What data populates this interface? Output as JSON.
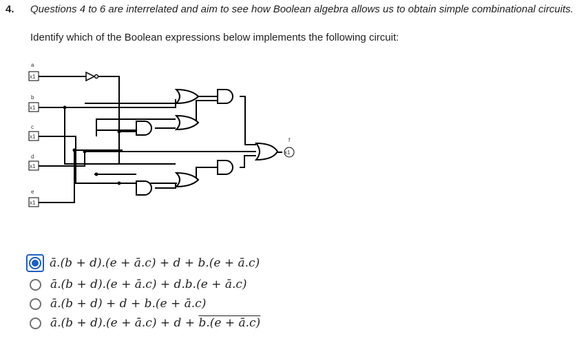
{
  "question": {
    "number": "4.",
    "intro": "Questions 4 to 6 are interrelated and aim to see how Boolean algebra allows us to obtain simple combinational circuits.",
    "prompt": "Identify which of the Boolean expressions below implements the following circuit:"
  },
  "circuit": {
    "inputs": [
      {
        "name": "a",
        "box": "x1"
      },
      {
        "name": "b",
        "box": "x1"
      },
      {
        "name": "c",
        "box": "x1"
      },
      {
        "name": "d",
        "box": "x1"
      },
      {
        "name": "e",
        "box": "x1"
      }
    ],
    "output": {
      "name": "f",
      "box": "x1"
    },
    "gates": [
      "not",
      "or",
      "and",
      "and",
      "or",
      "or",
      "and",
      "and"
    ],
    "colors": {
      "wire": "#000000",
      "junction": "#000000"
    }
  },
  "options": [
    {
      "id": "opt1",
      "prefix": "ā.(b + d).(e + ā.c) + d + b.(e + ā.c)",
      "overlined": "",
      "selected": true
    },
    {
      "id": "opt2",
      "prefix": "ā.(b + d).(e + ā.c) + d.b.(e + ā.c)",
      "overlined": "",
      "selected": false
    },
    {
      "id": "opt3",
      "prefix": "ā.(b + d) + d + b.(e + ā.c)",
      "overlined": "",
      "selected": false
    },
    {
      "id": "opt4",
      "prefix": "ā.(b + d).(e + ā.c) + d + ",
      "overlined": "b.(e + ā.c)",
      "selected": false
    }
  ],
  "colors": {
    "accent": "#1c5fbf",
    "radio_border": "#707070"
  }
}
